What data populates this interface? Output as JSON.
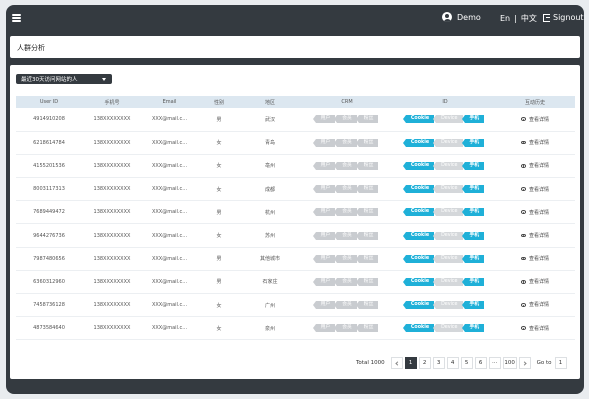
{
  "header": {
    "user": "Demo",
    "lang_en": "En",
    "lang_sep": "|",
    "lang_zh": "中文",
    "signout": "Signout"
  },
  "page_title": "人群分析",
  "filter": {
    "selected": "最近30天访问网站的人"
  },
  "table": {
    "columns": [
      "User ID",
      "手机号",
      "Email",
      "性别",
      "地区",
      "CRM",
      "ID",
      "互动历史"
    ],
    "crm_tags": [
      "用户",
      "会员",
      "粉丝"
    ],
    "id_tags": [
      "Cookie",
      "Device",
      "手机"
    ],
    "detail_label": "查看详情",
    "rows": [
      {
        "id": "4914910208",
        "phone": "138XXXXXXXX",
        "email": "XXX@mail.c...",
        "gender": "男",
        "region": "武汉"
      },
      {
        "id": "6218614784",
        "phone": "138XXXXXXXX",
        "email": "XXX@mail.c...",
        "gender": "女",
        "region": "青岛"
      },
      {
        "id": "4155201536",
        "phone": "138XXXXXXXX",
        "email": "XXX@mail.c...",
        "gender": "女",
        "region": "亳州"
      },
      {
        "id": "8003117313",
        "phone": "138XXXXXXXX",
        "email": "XXX@mail.c...",
        "gender": "女",
        "region": "成都"
      },
      {
        "id": "7689449472",
        "phone": "138XXXXXXXX",
        "email": "XXX@mail.c...",
        "gender": "男",
        "region": "杭州"
      },
      {
        "id": "9644276736",
        "phone": "138XXXXXXXX",
        "email": "XXX@mail.c...",
        "gender": "女",
        "region": "苏州"
      },
      {
        "id": "7987480656",
        "phone": "138XXXXXXXX",
        "email": "XXX@mail.c...",
        "gender": "男",
        "region": "其他城市"
      },
      {
        "id": "6360312960",
        "phone": "138XXXXXXXX",
        "email": "XXX@mail.c...",
        "gender": "男",
        "region": "石家庄"
      },
      {
        "id": "7458736128",
        "phone": "138XXXXXXXX",
        "email": "XXX@mail.c...",
        "gender": "女",
        "region": "广州"
      },
      {
        "id": "4873584640",
        "phone": "138XXXXXXXX",
        "email": "XXX@mail.c...",
        "gender": "女",
        "region": "泉州"
      }
    ]
  },
  "pagination": {
    "total": "Total 1000",
    "pages": [
      "1",
      "2",
      "3",
      "4",
      "5",
      "6"
    ],
    "ellipsis": "···",
    "last": "100",
    "goto": "Go to",
    "goto_value": "1"
  }
}
